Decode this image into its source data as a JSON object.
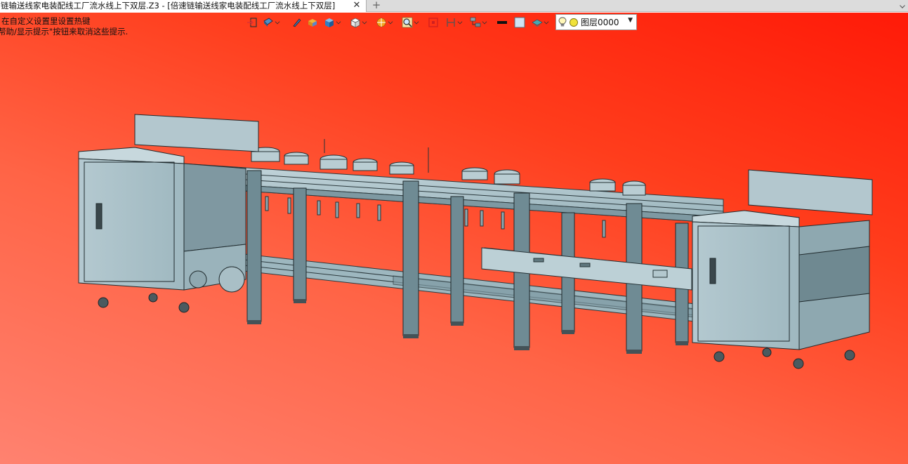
{
  "tab": {
    "title": "链输送线家电装配线工厂流水线上下双层.Z3 - [倍速链输送线家电装配线工厂流水线上下双层]",
    "close_icon": "close-icon",
    "new_tab_glyph": "+"
  },
  "viewport": {
    "hint_line1": "在自定义设置里设置热键",
    "hint_line2": "帮助/显示提示\"按钮来取消这些提示.",
    "background_top": "#ff1a08",
    "background_bottom": "#ff8270",
    "model_color": "#a9c2c9"
  },
  "toolbar": {
    "buttons": [
      {
        "name": "exit-icon"
      },
      {
        "name": "render-mode-icon",
        "dropdown": true
      },
      {
        "name": "pen-icon"
      },
      {
        "name": "material-icon"
      },
      {
        "name": "shaded-cube-icon",
        "dropdown": true
      },
      {
        "name": "view-cube-icon",
        "dropdown": true
      },
      {
        "name": "orientation-icon",
        "dropdown": true
      },
      {
        "name": "zoom-icon",
        "dropdown": true
      },
      {
        "name": "zoom-extents-icon"
      },
      {
        "name": "section-icon",
        "dropdown": true
      },
      {
        "name": "hierarchy-icon",
        "dropdown": true
      },
      {
        "name": "line-color-icon"
      },
      {
        "name": "face-color-icon"
      },
      {
        "name": "layer-stack-icon",
        "dropdown": true
      }
    ],
    "layer": {
      "label": "图层0000",
      "bulb_icon": "light-bulb-icon",
      "status_icon": "layer-status-icon"
    }
  }
}
